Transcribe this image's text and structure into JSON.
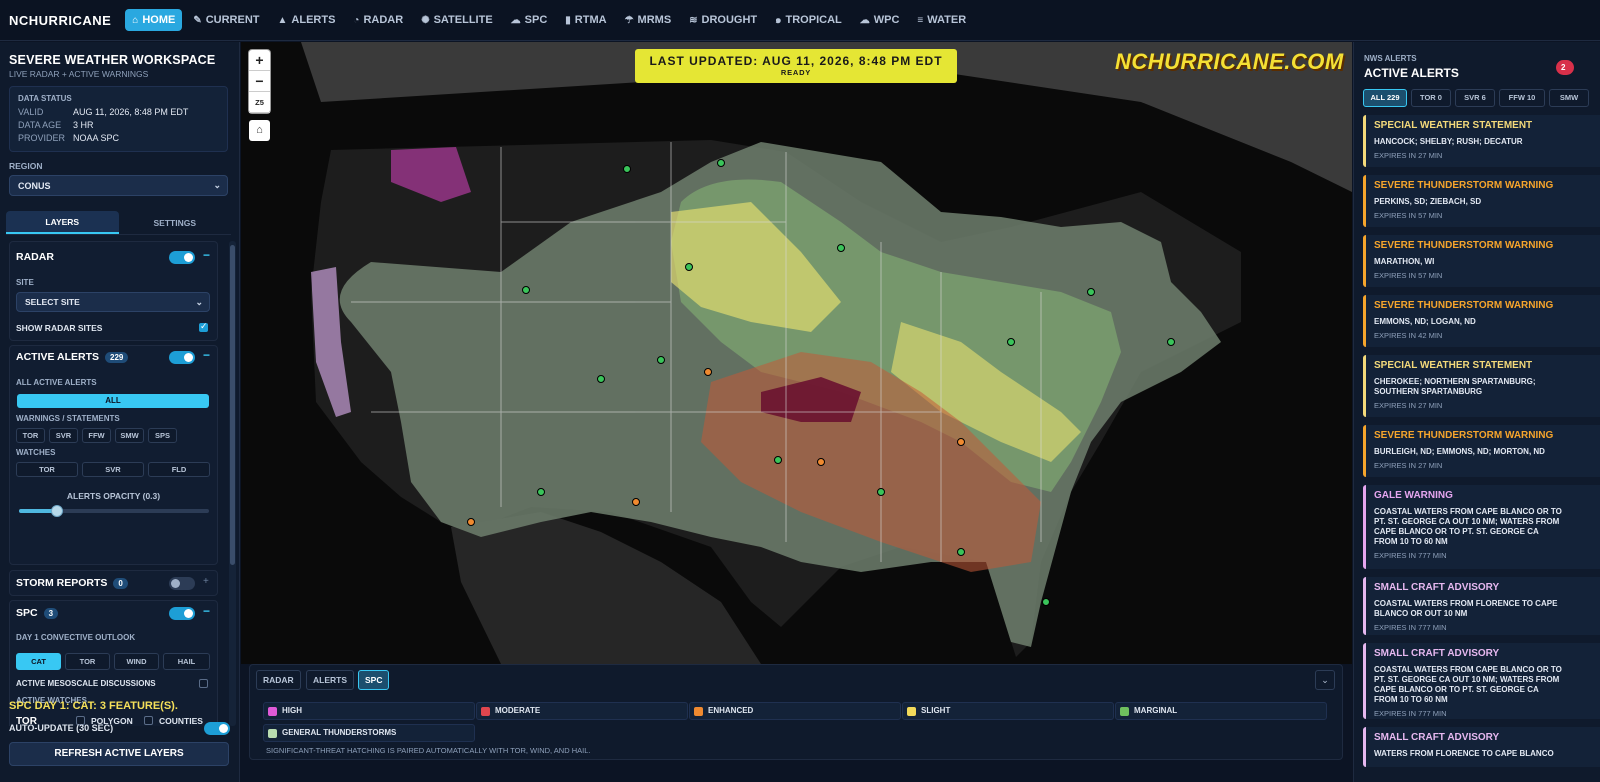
{
  "brand": "NCHURRICANE",
  "nav": [
    {
      "label": "HOME",
      "icon": "home-icon",
      "glyph": "⌂",
      "active": true
    },
    {
      "label": "CURRENT",
      "icon": "pencil-icon",
      "glyph": "✎"
    },
    {
      "label": "ALERTS",
      "icon": "warning-icon",
      "glyph": "▲"
    },
    {
      "label": "RADAR",
      "icon": "radar-icon",
      "glyph": "◔"
    },
    {
      "label": "SATELLITE",
      "icon": "satellite-icon",
      "glyph": "✺"
    },
    {
      "label": "SPC",
      "icon": "storm-icon",
      "glyph": "☁"
    },
    {
      "label": "RTMA",
      "icon": "thermometer-icon",
      "glyph": "▮"
    },
    {
      "label": "MRMS",
      "icon": "rain-icon",
      "glyph": "☂"
    },
    {
      "label": "DROUGHT",
      "icon": "drought-icon",
      "glyph": "≋"
    },
    {
      "label": "TROPICAL",
      "icon": "hurricane-icon",
      "glyph": "๑"
    },
    {
      "label": "WPC",
      "icon": "cloud-icon",
      "glyph": "☁"
    },
    {
      "label": "WATER",
      "icon": "waves-icon",
      "glyph": "≡"
    }
  ],
  "workspace": {
    "title": "SEVERE WEATHER WORKSPACE",
    "subtitle": "LIVE RADAR + ACTIVE WARNINGS"
  },
  "data_status": {
    "heading": "DATA STATUS",
    "rows": [
      {
        "k": "VALID",
        "v": "AUG 11, 2026, 8:48 PM EDT"
      },
      {
        "k": "DATA AGE",
        "v": "3 HR"
      },
      {
        "k": "PROVIDER",
        "v": "NOAA SPC"
      }
    ]
  },
  "region": {
    "label": "REGION",
    "value": "CONUS"
  },
  "left_tabs": [
    "LAYERS",
    "SETTINGS"
  ],
  "radar": {
    "title": "RADAR",
    "site_label": "SITE",
    "site_value": "SELECT SITE",
    "show_sites": "SHOW RADAR SITES"
  },
  "active_alerts": {
    "title": "ACTIVE ALERTS",
    "count": "229",
    "all_label": "ALL ACTIVE ALERTS",
    "all_button": "ALL",
    "warnings_label": "WARNINGS / STATEMENTS",
    "warnings": [
      "TOR",
      "SVR",
      "FFW",
      "SMW",
      "SPS"
    ],
    "watches_label": "WATCHES",
    "watches": [
      "TOR",
      "SVR",
      "FLD"
    ],
    "opacity_label": "ALERTS OPACITY (0.3)",
    "opacity_value": 0.3
  },
  "storm_reports": {
    "title": "STORM REPORTS",
    "count": "0"
  },
  "spc": {
    "title": "SPC",
    "count": "3",
    "outlook_label": "DAY 1 CONVECTIVE OUTLOOK",
    "outlook_tabs": [
      "CAT",
      "TOR",
      "WIND",
      "HAIL"
    ],
    "meso_label": "ACTIVE MESOSCALE DISCUSSIONS",
    "watches_label": "ACTIVE WATCHES",
    "tor_label": "TOR",
    "polygon_label": "POLYGON",
    "counties_label": "COUNTIES"
  },
  "spc_summary": "SPC DAY 1: CAT: 3 FEATURE(S).",
  "auto_update": "AUTO-UPDATE (30 SEC)",
  "refresh_button": "REFRESH ACTIVE LAYERS",
  "map": {
    "zoom_in": "+",
    "zoom_out": "−",
    "zoom_level": "Z5",
    "home": "⌂",
    "banner_main": "LAST UPDATED: AUG 11, 2026, 8:48 PM EDT",
    "banner_sub": "READY",
    "logo": "NCHURRICANE.COM"
  },
  "bottom_tabs": [
    "RADAR",
    "ALERTS",
    "SPC"
  ],
  "legend": [
    {
      "label": "HIGH",
      "color": "#e05ad8"
    },
    {
      "label": "MODERATE",
      "color": "#e0464e"
    },
    {
      "label": "ENHANCED",
      "color": "#f08a30"
    },
    {
      "label": "SLIGHT",
      "color": "#f2d95a"
    },
    {
      "label": "MARGINAL",
      "color": "#6fbf5e"
    },
    {
      "label": "GENERAL THUNDERSTORMS",
      "color": "#b8dcb0"
    }
  ],
  "legend_note": "SIGNIFICANT-THREAT HATCHING IS PAIRED AUTOMATICALLY WITH TOR, WIND, AND HAIL.",
  "right": {
    "small": "NWS ALERTS",
    "title": "ACTIVE ALERTS",
    "badge": "2",
    "tabs": [
      "ALL 229",
      "TOR 0",
      "SVR 6",
      "FFW 10",
      "SMW"
    ]
  },
  "alerts": [
    {
      "title": "SPECIAL WEATHER STATEMENT",
      "area": "HANCOCK; SHELBY; RUSH; DECATUR",
      "expires": "EXPIRES IN 27 MIN",
      "color": "#f3d97a"
    },
    {
      "title": "SEVERE THUNDERSTORM WARNING",
      "area": "PERKINS, SD; ZIEBACH, SD",
      "expires": "EXPIRES IN 57 MIN",
      "color": "#f6a52c"
    },
    {
      "title": "SEVERE THUNDERSTORM WARNING",
      "area": "MARATHON, WI",
      "expires": "EXPIRES IN 57 MIN",
      "color": "#f6a52c"
    },
    {
      "title": "SEVERE THUNDERSTORM WARNING",
      "area": "EMMONS, ND; LOGAN, ND",
      "expires": "EXPIRES IN 42 MIN",
      "color": "#f6a52c"
    },
    {
      "title": "SPECIAL WEATHER STATEMENT",
      "area": "CHEROKEE; NORTHERN SPARTANBURG; SOUTHERN SPARTANBURG",
      "expires": "EXPIRES IN 27 MIN",
      "color": "#f3d97a"
    },
    {
      "title": "SEVERE THUNDERSTORM WARNING",
      "area": "BURLEIGH, ND; EMMONS, ND; MORTON, ND",
      "expires": "EXPIRES IN 27 MIN",
      "color": "#f6a52c"
    },
    {
      "title": "GALE WARNING",
      "area": "COASTAL WATERS FROM CAPE BLANCO OR TO PT. ST. GEORGE CA OUT 10 NM; WATERS FROM CAPE BLANCO OR TO PT. ST. GEORGE CA FROM 10 TO 60 NM",
      "expires": "EXPIRES IN 777 MIN",
      "color": "#e6a6f0"
    },
    {
      "title": "SMALL CRAFT ADVISORY",
      "area": "COASTAL WATERS FROM FLORENCE TO CAPE BLANCO OR OUT 10 NM",
      "expires": "EXPIRES IN 777 MIN",
      "color": "#e6b8f0"
    },
    {
      "title": "SMALL CRAFT ADVISORY",
      "area": "COASTAL WATERS FROM CAPE BLANCO OR TO PT. ST. GEORGE CA OUT 10 NM; WATERS FROM CAPE BLANCO OR TO PT. ST. GEORGE CA FROM 10 TO 60 NM",
      "expires": "EXPIRES IN 777 MIN",
      "color": "#e6b8f0"
    },
    {
      "title": "SMALL CRAFT ADVISORY",
      "area": "WATERS FROM FLORENCE TO CAPE BLANCO",
      "expires": "",
      "color": "#e6b8f0"
    }
  ]
}
